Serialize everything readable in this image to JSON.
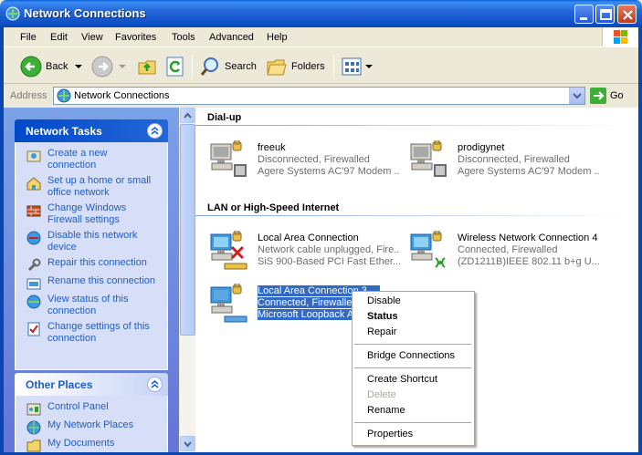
{
  "window": {
    "title": "Network Connections"
  },
  "menu": [
    "File",
    "Edit",
    "View",
    "Favorites",
    "Tools",
    "Advanced",
    "Help"
  ],
  "toolbar": {
    "back": "Back",
    "search": "Search",
    "folders": "Folders"
  },
  "address": {
    "label": "Address",
    "value": "Network Connections",
    "go": "Go"
  },
  "network_tasks": {
    "title": "Network Tasks",
    "items": [
      {
        "line1": "Create a new",
        "line2": "connection"
      },
      {
        "line1": "Set up a home or small",
        "line2": "office network"
      },
      {
        "line1": "Change Windows",
        "line2": "Firewall settings"
      },
      {
        "line1": "Disable this network",
        "line2": "device"
      },
      {
        "line1": "Repair this connection",
        "line2": ""
      },
      {
        "line1": "Rename this connection",
        "line2": ""
      },
      {
        "line1": "View status of this",
        "line2": "connection"
      },
      {
        "line1": "Change settings of this",
        "line2": "connection"
      }
    ]
  },
  "other_places": {
    "title": "Other Places",
    "items": [
      "Control Panel",
      "My Network Places",
      "My Documents"
    ]
  },
  "groups": {
    "dialup": "Dial-up",
    "lan": "LAN or High-Speed Internet"
  },
  "connections": {
    "freeuk": {
      "name": "freeuk",
      "status": "Disconnected, Firewalled",
      "device": "Agere Systems AC'97 Modem ..."
    },
    "prodigynet": {
      "name": "prodigynet",
      "status": "Disconnected, Firewalled",
      "device": "Agere Systems AC'97 Modem ..."
    },
    "lac": {
      "name": "Local Area Connection",
      "status": "Network cable unplugged, Fire...",
      "device": "SiS 900-Based PCI Fast Ether..."
    },
    "wireless": {
      "name": "Wireless Network Connection 4",
      "status": "Connected, Firewalled",
      "device": "(ZD1211B)IEEE 802.11 b+g U..."
    },
    "lac3": {
      "name": "Local Area Connection 3",
      "status": "Connected, Firewalled",
      "device": "Microsoft Loopback Adapter"
    }
  },
  "context_menu": {
    "disable": "Disable",
    "status": "Status",
    "repair": "Repair",
    "bridge": "Bridge Connections",
    "shortcut": "Create Shortcut",
    "delete": "Delete",
    "rename": "Rename",
    "properties": "Properties"
  }
}
